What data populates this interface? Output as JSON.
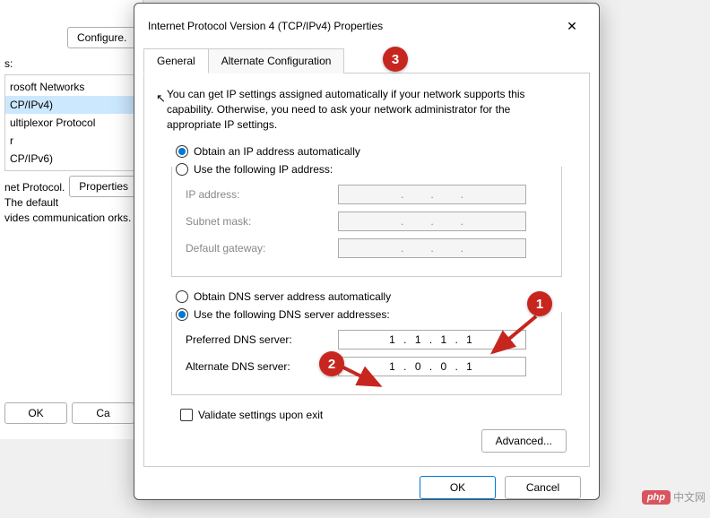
{
  "bg": {
    "configure": "Configure.",
    "connlabel": "s:",
    "items": [
      "rosoft Networks",
      "CP/IPv4)",
      "ultiplexor Protocol",
      "r",
      "CP/IPv6)"
    ],
    "properties": "Properties",
    "desc": "net Protocol. The default vides communication orks.",
    "ok": "OK",
    "cancel": "Ca"
  },
  "dialog": {
    "title": "Internet Protocol Version 4 (TCP/IPv4) Properties",
    "tabs": {
      "general": "General",
      "alternate": "Alternate Configuration"
    },
    "desc": "You can get IP settings assigned automatically if your network supports this capability. Otherwise, you need to ask your network administrator for the appropriate IP settings.",
    "ip": {
      "auto": "Obtain an IP address automatically",
      "manual": "Use the following IP address:",
      "address": "IP address:",
      "subnet": "Subnet mask:",
      "gateway": "Default gateway:"
    },
    "dns": {
      "auto": "Obtain DNS server address automatically",
      "manual": "Use the following DNS server addresses:",
      "preferred": "Preferred DNS server:",
      "alternate": "Alternate DNS server:",
      "preferred_value": "1 . 1 . 1 . 1",
      "alternate_value": "1 . 0 . 0 . 1"
    },
    "validate": "Validate settings upon exit",
    "advanced": "Advanced...",
    "ok": "OK",
    "cancel": "Cancel"
  },
  "annotations": {
    "a1": "1",
    "a2": "2",
    "a3": "3"
  },
  "watermark": {
    "badge": "php",
    "text": "中文网"
  }
}
